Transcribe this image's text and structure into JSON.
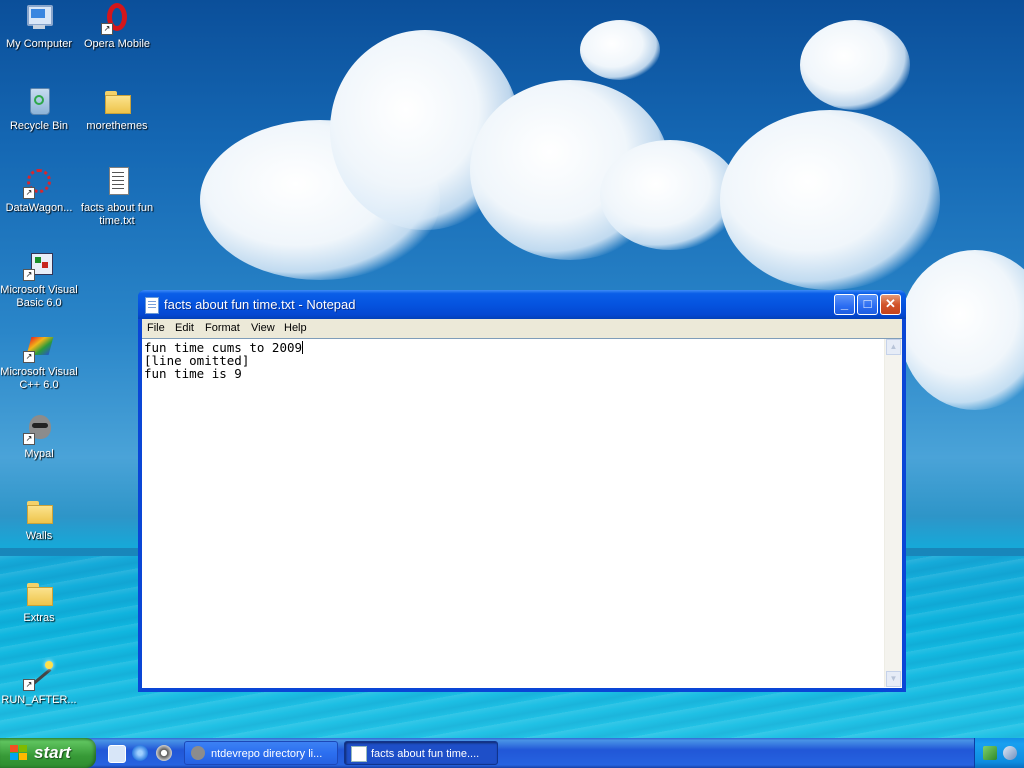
{
  "desktop": {
    "icons": [
      {
        "label": "My Computer",
        "icon": "my-computer-icon"
      },
      {
        "label": "Opera Mobile",
        "icon": "opera-icon"
      },
      {
        "label": "Recycle Bin",
        "icon": "recycle-bin-icon"
      },
      {
        "label": "morethemes",
        "icon": "folder-icon"
      },
      {
        "label": "DataWagon...",
        "icon": "datawagon-icon"
      },
      {
        "label": "facts about fun time.txt",
        "icon": "text-file-icon"
      },
      {
        "label": "Microsoft Visual Basic 6.0",
        "icon": "visual-basic-icon"
      },
      {
        "label": "Microsoft Visual C++ 6.0",
        "icon": "visual-cpp-icon"
      },
      {
        "label": "Mypal",
        "icon": "mypal-icon"
      },
      {
        "label": "Walls",
        "icon": "folder-icon"
      },
      {
        "label": "Extras",
        "icon": "folder-icon"
      },
      {
        "label": "RUN_AFTER...",
        "icon": "wand-icon"
      }
    ]
  },
  "notepad": {
    "title": "facts about fun time.txt - Notepad",
    "menu": [
      "File",
      "Edit",
      "Format",
      "View",
      "Help"
    ],
    "lines": [
      "fun time cums to 2009",
      "[line omitted]",
      "fun time is 9"
    ],
    "buttons": {
      "minimize": "_",
      "maximize": "□",
      "close": "✕"
    }
  },
  "taskbar": {
    "start_label": "start",
    "quick_launch": [
      "show-desktop-icon",
      "internet-explorer-icon",
      "media-player-icon"
    ],
    "tasks": [
      {
        "label": "ntdevrepo directory li...",
        "active": false
      },
      {
        "label": "facts about fun time....",
        "active": true
      }
    ],
    "tray_icons": [
      "network-icon",
      "safely-remove-icon"
    ]
  },
  "colors": {
    "taskbar_blue": "#2157d7",
    "start_green": "#379a37",
    "window_blue": "#0553df",
    "close_red": "#d2542a"
  }
}
